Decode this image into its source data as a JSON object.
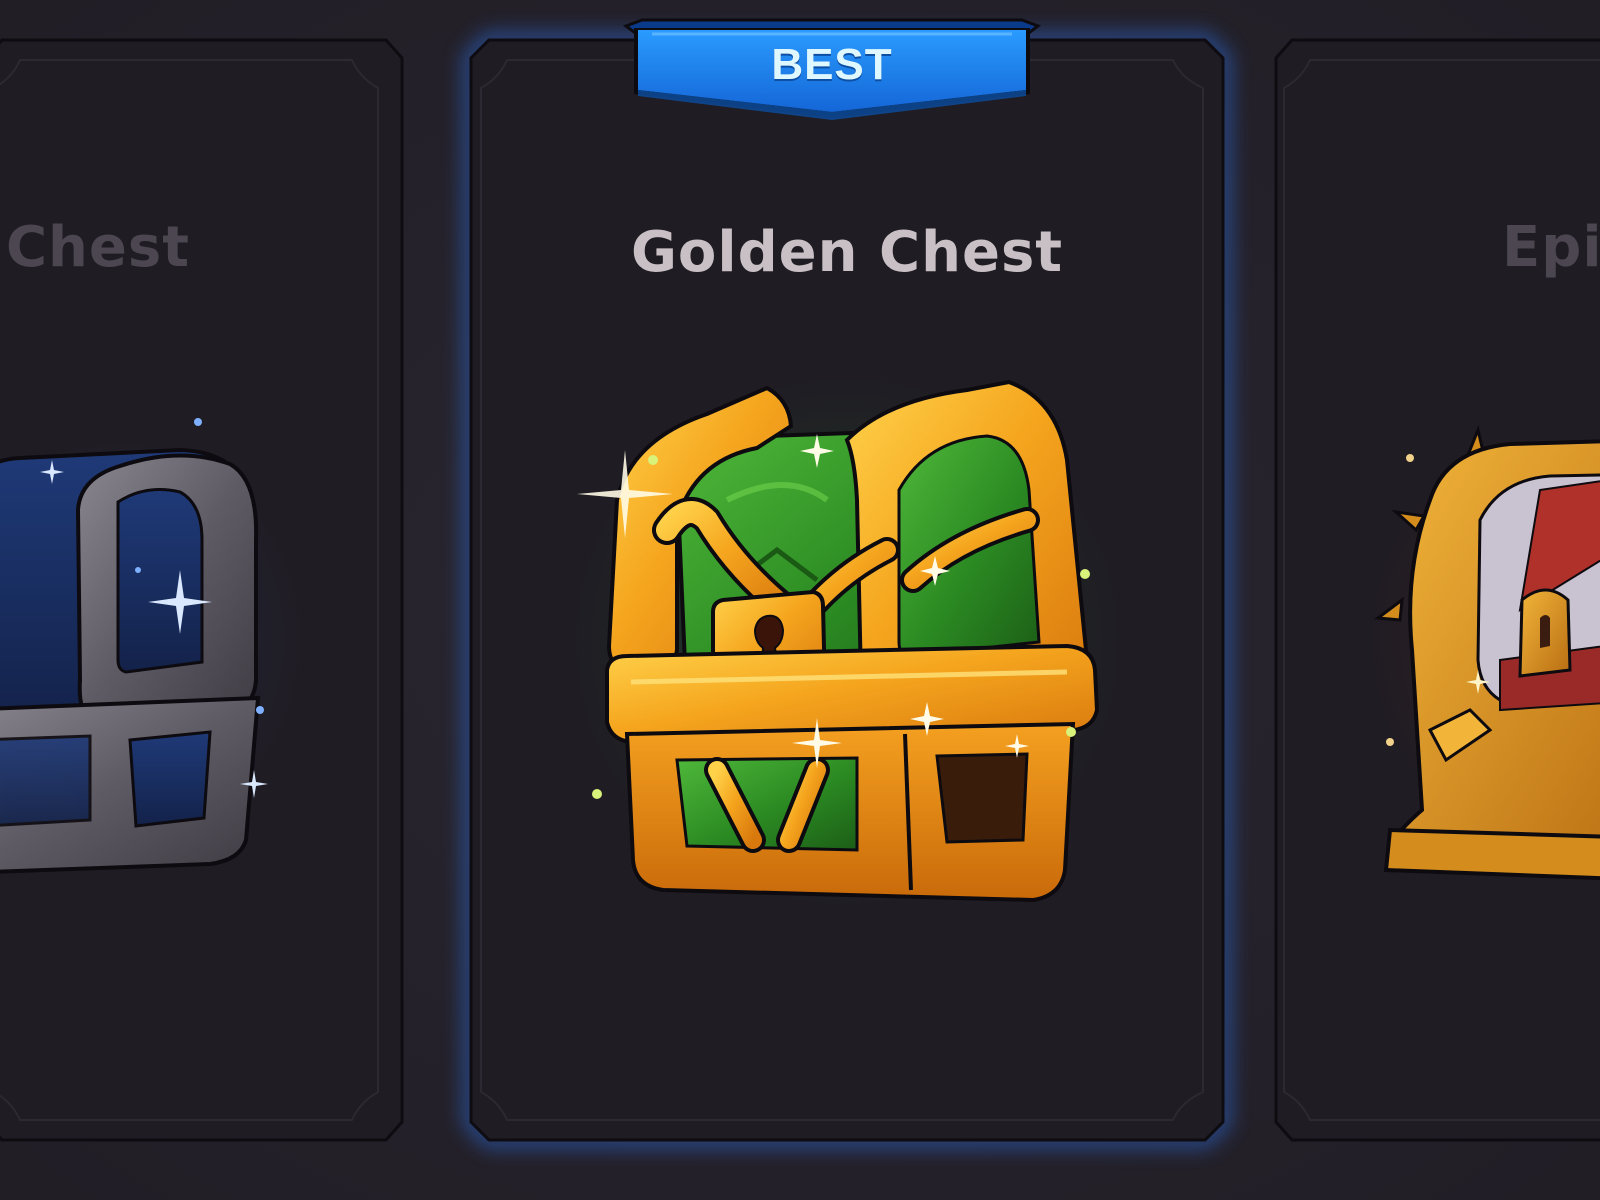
{
  "screen": {
    "title": "chest-selection"
  },
  "badge": {
    "label": "BEST",
    "color": "#1f7fe6"
  },
  "cards": {
    "left": {
      "title": "r Chest",
      "chest_icon": "silver-chest-icon",
      "accent_color": "#3b6fd1"
    },
    "center": {
      "title": "Golden Chest",
      "chest_icon": "golden-chest-icon",
      "accent_color": "#f2a21a",
      "glow_color": "#2f6b3a",
      "selected": true
    },
    "right": {
      "title": "Epic",
      "chest_icon": "epic-chest-icon",
      "accent_color": "#d9472b"
    }
  },
  "colors": {
    "background": "#26222c",
    "card_fill": "#1f1c23",
    "card_border": "#0e0c10",
    "selection_glow": "#2a7bff"
  }
}
